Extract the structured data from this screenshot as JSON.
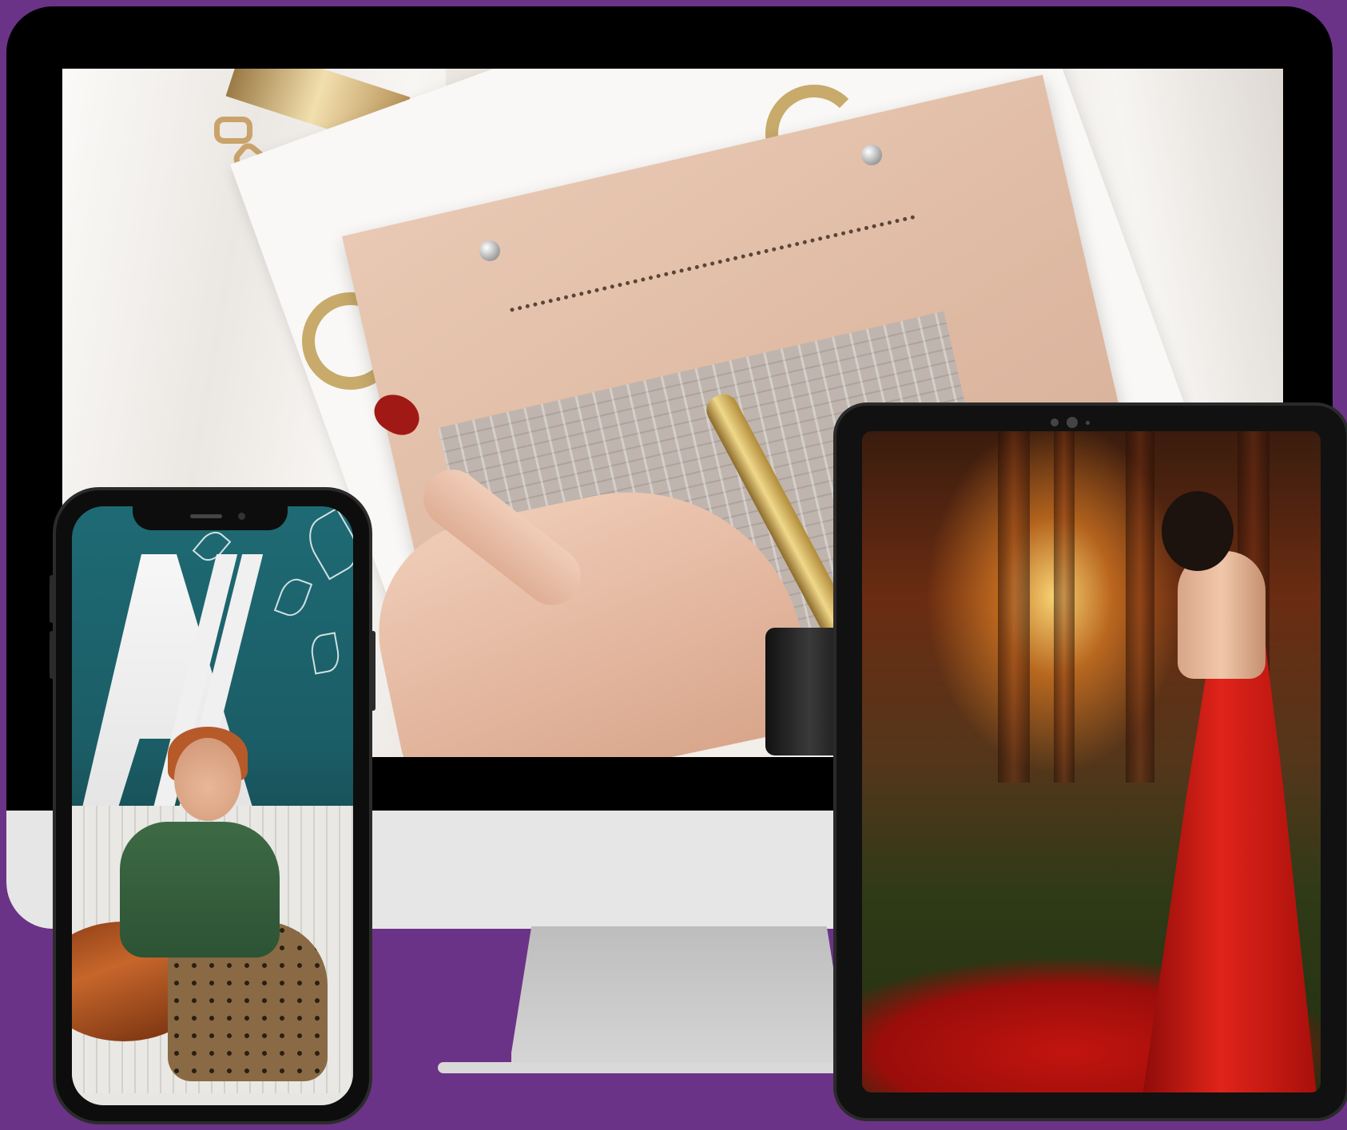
{
  "scene": {
    "background_color": "#6b3387",
    "devices": [
      {
        "name": "desktop-monitor",
        "screen_content": "leather-clutch-photo"
      },
      {
        "name": "tablet",
        "screen_content": "red-dress-forest-photo"
      },
      {
        "name": "smartphone",
        "screen_content": "woman-seated-photo"
      }
    ]
  },
  "colors": {
    "frame": "#0d0d0d",
    "chin": "#e6e6e6",
    "stand": "#c4c4c4"
  }
}
